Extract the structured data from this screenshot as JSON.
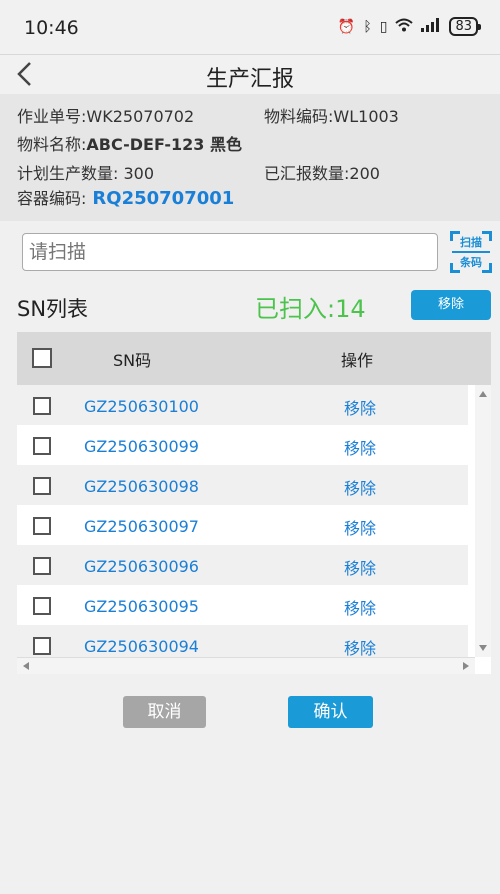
{
  "status_bar": {
    "time": "10:46",
    "battery": "83"
  },
  "header": {
    "title": "生产汇报"
  },
  "info": {
    "order_label": "作业单号:",
    "order_value": "WK25070702",
    "material_code_label": "物料编码:",
    "material_code_value": "WL1003",
    "material_name_label": "物料名称:",
    "material_name_value": "ABC-DEF-123 黑色",
    "plan_qty_label": "计划生产数量:",
    "plan_qty_value": "300",
    "reported_qty_label": "已汇报数量:",
    "reported_qty_value": "200",
    "container_label": "容器编码:",
    "container_value": "RQ250707001"
  },
  "scan": {
    "placeholder": "请扫描",
    "button_line1": "扫描",
    "button_line2": "条码"
  },
  "sn_list": {
    "title": "SN列表",
    "scanned_text": "已扫入:14",
    "remove_button": "移除",
    "columns": [
      "SN码",
      "操作"
    ],
    "rows": [
      {
        "sn": "GZ250630100",
        "action": "移除"
      },
      {
        "sn": "GZ250630099",
        "action": "移除"
      },
      {
        "sn": "GZ250630098",
        "action": "移除"
      },
      {
        "sn": "GZ250630097",
        "action": "移除"
      },
      {
        "sn": "GZ250630096",
        "action": "移除"
      },
      {
        "sn": "GZ250630095",
        "action": "移除"
      },
      {
        "sn": "GZ250630094",
        "action": "移除"
      }
    ]
  },
  "footer": {
    "cancel": "取消",
    "confirm": "确认"
  },
  "colors": {
    "accent": "#1a9bd8",
    "link": "#1a7fd6",
    "success": "#4cc34c"
  }
}
